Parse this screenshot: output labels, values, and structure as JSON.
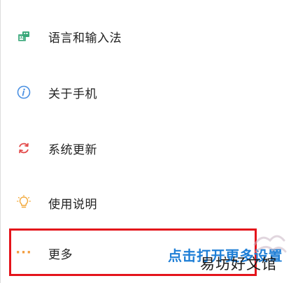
{
  "settings": {
    "items": [
      {
        "label": "语言和输入法",
        "icon": "language-keyboard-icon",
        "color": "#3aa87a"
      },
      {
        "label": "关于手机",
        "icon": "info-icon",
        "color": "#4a90e2"
      },
      {
        "label": "系统更新",
        "icon": "refresh-icon",
        "color": "#e34b4b"
      },
      {
        "label": "使用说明",
        "icon": "lightbulb-icon",
        "color": "#f2a93b"
      },
      {
        "label": "更多",
        "icon": "more-dots-icon",
        "color": "#f39c3d"
      }
    ]
  },
  "annotation": {
    "highlight_color": "#e4141b",
    "caption": "点击打开更多设置",
    "caption_color": "#1f7fd6"
  },
  "watermark": {
    "text": "易坊好文馆"
  }
}
